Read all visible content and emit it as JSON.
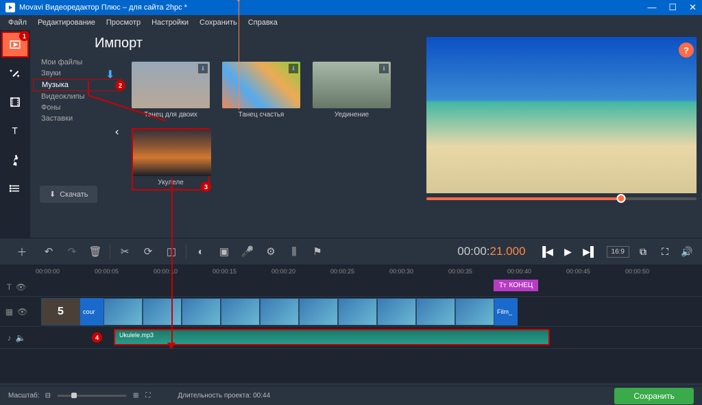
{
  "window": {
    "title": "Movavi Видеоредактор Плюс – для сайта 2hpc *"
  },
  "menu": {
    "file": "Файл",
    "edit": "Редактирование",
    "view": "Просмотр",
    "settings": "Настройки",
    "save": "Сохранить",
    "help": "Справка"
  },
  "panel": {
    "title": "Импорт",
    "categories": {
      "myfiles": "Мои файлы",
      "sounds": "Звуки",
      "music": "Музыка",
      "videoclips": "Видеоклипы",
      "backgrounds": "Фоны",
      "intros": "Заставки"
    },
    "download": "Скачать"
  },
  "gallery": {
    "items": [
      {
        "label": "Танец для двоих"
      },
      {
        "label": "Танец счастья"
      },
      {
        "label": "Уединение"
      },
      {
        "label": "Укулеле"
      }
    ]
  },
  "badges": {
    "b1": "1",
    "b2": "2",
    "b3": "3",
    "b4": "4"
  },
  "timecode": {
    "hh": "00:",
    "mm": "00:",
    "ss": "21.000"
  },
  "aspect": "16:9",
  "timeline": {
    "ticks": [
      "00:00:00",
      "00:00:05",
      "00:00:10",
      "00:00:15",
      "00:00:20",
      "00:00:25",
      "00:00:30",
      "00:00:35",
      "00:00:40",
      "00:00:45",
      "00:00:50"
    ],
    "end_label": "КОНЕЦ",
    "countdown": "5",
    "clip_start": "cour",
    "clip_end": "Film_",
    "audio_name": "Ukulele.mp3"
  },
  "bottom": {
    "scale_label": "Масштаб:",
    "duration_label": "Длительность проекта:",
    "duration_value": "00:44",
    "save": "Сохранить"
  }
}
